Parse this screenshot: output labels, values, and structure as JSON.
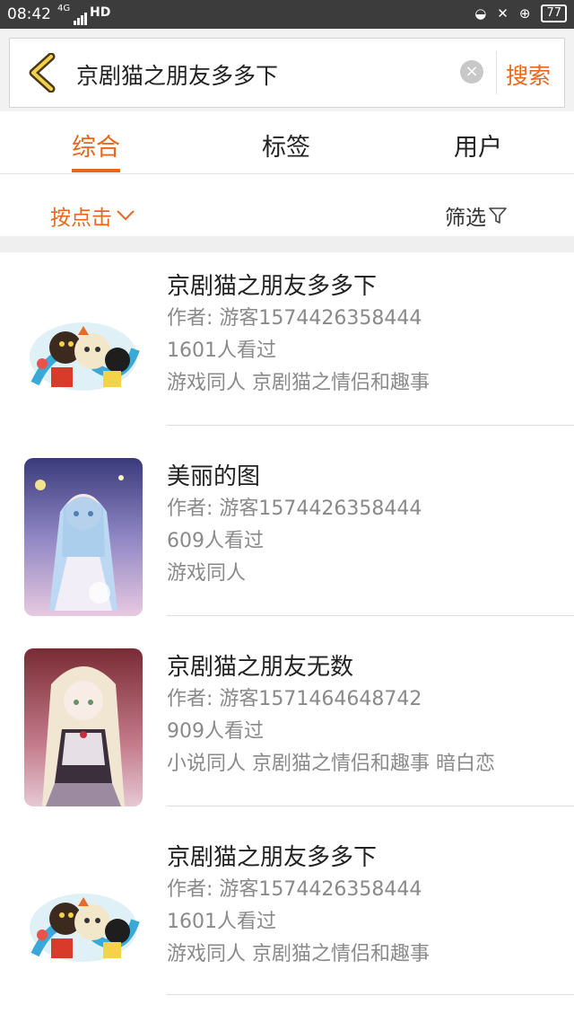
{
  "status_bar": {
    "time": "08:42",
    "network": "4G",
    "hd": "HD",
    "battery": "77"
  },
  "search": {
    "query": "京剧猫之朋友多多下",
    "clear_label": "×",
    "search_label": "搜索"
  },
  "tabs": [
    {
      "label": "综合",
      "active": true
    },
    {
      "label": "标签",
      "active": false
    },
    {
      "label": "用户",
      "active": false
    }
  ],
  "filters": {
    "sort_label": "按点击",
    "filter_label": "筛选"
  },
  "accent_color": "#e8671f",
  "results": [
    {
      "title": "京剧猫之朋友多多下",
      "author": "作者: 游客1574426358444",
      "views": "1601人看过",
      "tags": "游戏同人 京剧猫之情侣和趣事",
      "thumb_icon": "cartoon-cats-thumbnail"
    },
    {
      "title": "美丽的图",
      "author": "作者: 游客1574426358444",
      "views": "609人看过",
      "tags": "游戏同人",
      "thumb_icon": "anime-girl-blue-thumbnail"
    },
    {
      "title": "京剧猫之朋友无数",
      "author": "作者: 游客1571464648742",
      "views": "909人看过",
      "tags": "小说同人 京剧猫之情侣和趣事 暗白恋",
      "thumb_icon": "anime-girl-pink-thumbnail"
    },
    {
      "title": "京剧猫之朋友多多下",
      "author": "作者: 游客1574426358444",
      "views": "1601人看过",
      "tags": "游戏同人 京剧猫之情侣和趣事",
      "thumb_icon": "cartoon-cats-thumbnail"
    }
  ]
}
